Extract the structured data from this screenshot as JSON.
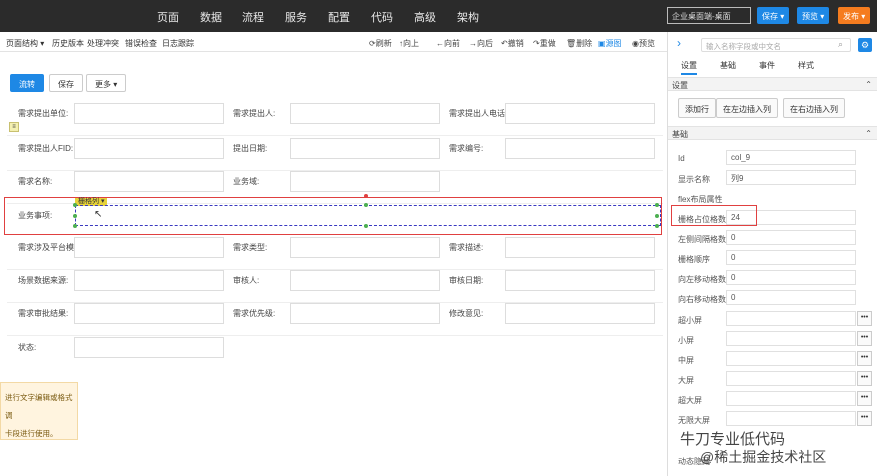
{
  "nav": {
    "items": [
      "页面",
      "数据",
      "流程",
      "服务",
      "配置",
      "代码",
      "高级",
      "架构"
    ],
    "active": "页面"
  },
  "top_right": {
    "app_select": "企业桌面端-桌面",
    "save": "保存 ▾",
    "preview": "预览 ▾",
    "publish": "发布 ▾"
  },
  "toolbar": {
    "left": [
      "页面结构 ▾",
      "历史版本",
      "处理冲突",
      "错误检查",
      "日志跟踪"
    ],
    "right": [
      "刷新",
      "向上",
      "向前",
      "向后",
      "撤销",
      "重做",
      "删除",
      "源图",
      "预览"
    ]
  },
  "canvas": {
    "buttons": {
      "submit": "流转",
      "save": "保存",
      "more": "更多 ▾"
    },
    "rows": [
      [
        "需求提出单位:",
        "需求提出人:",
        "需求提出人电话"
      ],
      [
        "需求提出人FID:",
        "提出日期:",
        "需求编号:"
      ],
      [
        "需求名称:",
        "业务域:",
        ""
      ],
      [
        "需求涉及平台模:",
        "需求类型:",
        "需求描述:"
      ],
      [
        "场景数据来源:",
        "审核人:",
        "审核日期:"
      ],
      [
        "需求审批结果:",
        "需求优先级:",
        "修改意见:"
      ],
      [
        "状态:",
        "",
        ""
      ]
    ],
    "selected_row_label": "业务事项:",
    "col_tag": "栅格列 ▾",
    "toast_line1": "进行文字编辑或格式调",
    "toast_line2": "卡段进行使用。"
  },
  "panel": {
    "search_placeholder": "输入名称字段或中文名",
    "tabs": [
      "设置",
      "基础",
      "事件",
      "样式"
    ],
    "active_tab": "设置",
    "section_settings": "设置",
    "insert_buttons": [
      "添加行",
      "在左边插入列",
      "在右边插入列"
    ],
    "section_basic": "基础",
    "props": [
      {
        "label": "Id",
        "value": "col_9"
      },
      {
        "label": "显示名称",
        "value": "列9"
      },
      {
        "label": "flex布局属性",
        "value": ""
      },
      {
        "label": "栅格占位格数",
        "value": "24"
      },
      {
        "label": "左侧间隔格数",
        "value": "0"
      },
      {
        "label": "栅格顺序",
        "value": "0"
      },
      {
        "label": "向左移动格数",
        "value": "0"
      },
      {
        "label": "向右移动格数",
        "value": "0"
      }
    ],
    "screen_props": [
      "超小屏",
      "小屏",
      "中屏",
      "大屏",
      "超大屏",
      "无限大屏"
    ],
    "last_label": "动态隐藏"
  },
  "watermark": {
    "line1": "牛刀专业低代码",
    "line2": "@稀土掘金技术社区"
  },
  "colors": {
    "accent": "#1e88e5",
    "nav_bg": "#2b2b2b",
    "highlight": "#e04040",
    "publish": "#f57c1f"
  }
}
